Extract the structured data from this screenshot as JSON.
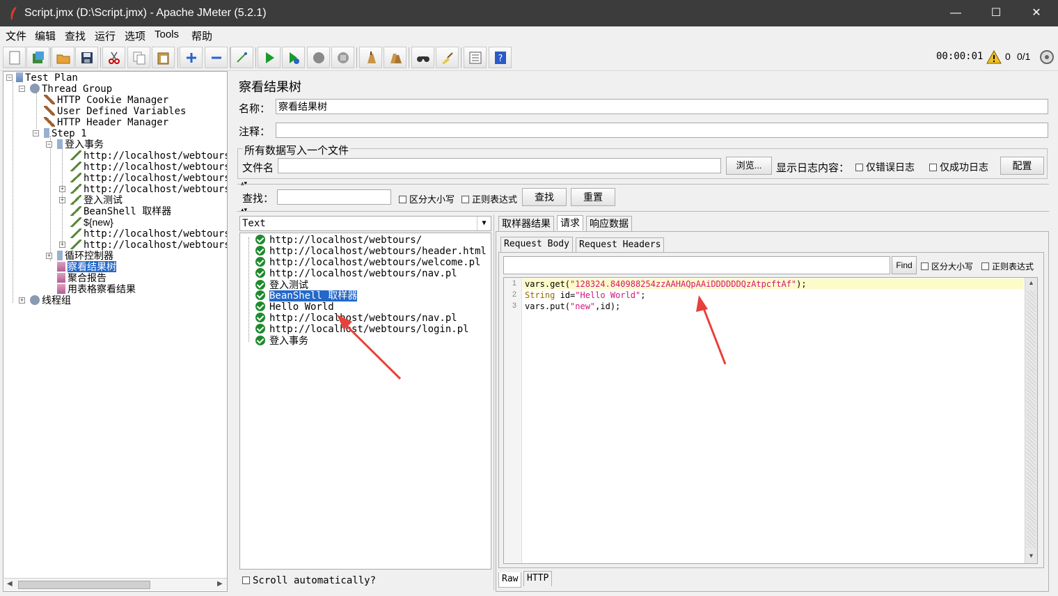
{
  "window": {
    "title": "Script.jmx (D:\\Script.jmx) - Apache JMeter (5.2.1)",
    "minimize": "—",
    "maximize": "☐",
    "close": "✕"
  },
  "menu": [
    "文件",
    "编辑",
    "查找",
    "运行",
    "选项",
    "Tools",
    "帮助"
  ],
  "toolbar": {
    "timer": "00:00:01",
    "warning_count": "0",
    "threads": "0/1",
    "icons": [
      "new-icon",
      "templates-icon",
      "open-icon",
      "save-icon",
      "cut-icon",
      "copy-icon",
      "paste-icon",
      "expand-icon",
      "collapse-icon",
      "toggle-icon",
      "start-icon",
      "start-no-pause-icon",
      "stop-icon",
      "shutdown-icon",
      "clear-icon",
      "clear-all-icon",
      "search-icon",
      "reset-search-icon",
      "function-helper-icon",
      "help-icon"
    ]
  },
  "tree": {
    "nodes": [
      {
        "label": "Test Plan"
      },
      {
        "label": "Thread Group"
      },
      {
        "label": "HTTP Cookie Manager"
      },
      {
        "label": "User Defined Variables"
      },
      {
        "label": "HTTP Header Manager"
      },
      {
        "label": "Step 1"
      },
      {
        "label": "登入事务"
      },
      {
        "label": "http://localhost/webtours/"
      },
      {
        "label": "http://localhost/webtours/"
      },
      {
        "label": "http://localhost/webtours/"
      },
      {
        "label": "http://localhost/webtours/"
      },
      {
        "label": "登入测试"
      },
      {
        "label": "BeanShell 取样器"
      },
      {
        "label": "${new}"
      },
      {
        "label": "http://localhost/webtours/"
      },
      {
        "label": "http://localhost/webtours/"
      },
      {
        "label": "循环控制器"
      },
      {
        "label": "察看结果树"
      },
      {
        "label": "聚合报告"
      },
      {
        "label": "用表格察看结果"
      },
      {
        "label": "线程组"
      }
    ]
  },
  "listener": {
    "title": "察看结果树",
    "name_label": "名称：",
    "name_value": "察看结果树",
    "comment_label": "注释：",
    "comment_value": "",
    "file_group_label": "所有数据写入一个文件",
    "filename_label": "文件名",
    "filename_value": "",
    "browse_button": "浏览...",
    "log_label": "显示日志内容：",
    "errors_only": "仅错误日志",
    "success_only": "仅成功日志",
    "config_button": "配置",
    "search_label": "查找：",
    "case_sensitive": "区分大小写",
    "regex": "正则表达式",
    "find_button": "查找",
    "reset_button": "重置"
  },
  "results": {
    "renderer": "Text",
    "items": [
      "http://localhost/webtours/",
      "http://localhost/webtours/header.html",
      "http://localhost/webtours/welcome.pl",
      "http://localhost/webtours/nav.pl",
      "登入测试",
      "BeanShell 取样器",
      "Hello World",
      "http://localhost/webtours/nav.pl",
      "http://localhost/webtours/login.pl",
      "登入事务"
    ],
    "scroll_auto": "Scroll automatically?"
  },
  "detail": {
    "tabs": [
      "取样器结果",
      "请求",
      "响应数据"
    ],
    "subtabs": [
      "Request Body",
      "Request Headers"
    ],
    "find_button": "Find",
    "case_sensitive": "区分大小写",
    "regex": "正则表达式",
    "bottom_tabs": [
      "Raw",
      "HTTP"
    ],
    "code_lines": [
      {
        "n": "1",
        "a": "vars.get(",
        "s": "\"128324.840988254zzAAHAQpAAiDDDDDDQzAtpcftAf\"",
        "b": ");"
      },
      {
        "n": "2",
        "a": "String",
        "b2": " id=",
        "s": "\"Hello World\"",
        "b": ";"
      },
      {
        "n": "3",
        "a": "vars.put(",
        "s": "\"new\"",
        "b": ",id);"
      }
    ]
  }
}
